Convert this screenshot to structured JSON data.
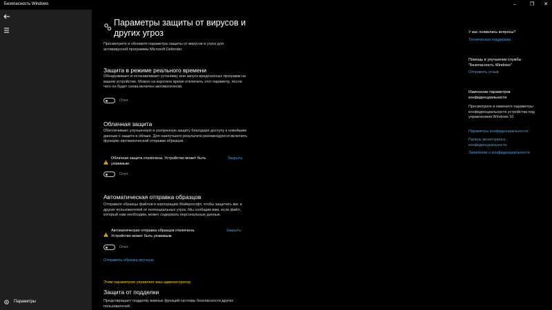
{
  "window": {
    "title": "Безопасность Windows"
  },
  "sidebar": {
    "settings_label": "Параметры"
  },
  "page": {
    "title": "Параметры защиты от вирусов и других угроз",
    "intro": "Просмотрите и обновите параметры защиты от вирусов и угроз для антивирусной программы Microsoft Defender."
  },
  "sections": {
    "realtime": {
      "title": "Защита в режиме реального времени",
      "desc": "Обнаруживает и останавливает установку или запуск вредоносных программ на вашем устройстве. Можно на короткое время отключить этот параметр, после чего он будет снова включен автоматически.",
      "toggle_state": "Откл."
    },
    "cloud": {
      "title": "Облачная защита",
      "desc": "Обеспечивает улучшенную и ускоренную защиту благодаря доступу к новейшим данным о защите в облаке. Для наилучшего результата рекомендуется включить функцию автоматической отправки образцов.",
      "warning": "Облачная защита отключена. Устройство может быть уязвимым.",
      "dismiss": "Закрыть",
      "toggle_state": "Откл."
    },
    "samples": {
      "title": "Автоматическая отправка образцов",
      "desc": "Отправьте образцы файлов в корпорацию Майкрософт, чтобы защитить вас и других пользователей от потенциальных угроз. Мы сообщим вам, если файл, который нам необходим, может содержать персональные данные.",
      "warning": "Автоматическая отправка образцов отключена. Устройство может быть уязвимым.",
      "dismiss": "Закрыть",
      "toggle_state": "Откл.",
      "manual_link": "Отправить образец вручную"
    },
    "admin_note": "Этим параметром управляет ваш администратор.",
    "tamper": {
      "title": "Защита от подделки",
      "desc": "Предотвращает подделку важных функций системы безопасности других пользователей."
    }
  },
  "right": {
    "questions": {
      "heading": "У вас появились вопросы?",
      "link": "Техническая поддержка"
    },
    "improve": {
      "heading": "Помощь в улучшении службы \"Безопасность Windows\"",
      "link": "Отправить отзыв"
    },
    "privacy": {
      "heading": "Изменение параметров конфиденциальности",
      "text": "Просмотрите и измените параметры конфиденциальности устройства под управлением Windows 10.",
      "links": [
        "Параметры конфиденциальности",
        "Панель мониторинга конфиденциальности",
        "Заявление о конфиденциальности"
      ]
    }
  },
  "colors": {
    "accent": "#4aa3e0",
    "warning": "#f2c811",
    "admin_note": "#f2d100",
    "sidebar_bg": "#1f1f1f"
  }
}
